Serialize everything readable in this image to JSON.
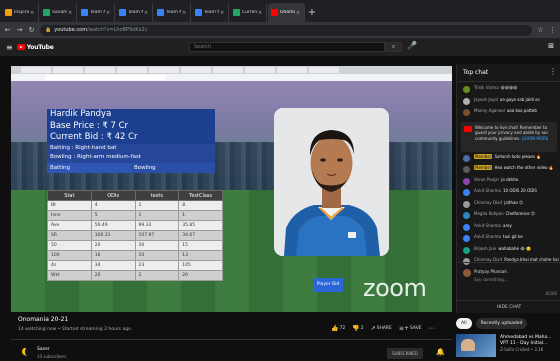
{
  "browser": {
    "tabs": [
      {
        "title": "Inspiration Desk - Bra",
        "color": "#f59e0b"
      },
      {
        "title": "Sanam Bai - Google Sheets",
        "color": "#22a565"
      },
      {
        "title": "Team Number 2 - Radhe",
        "color": "#3b82f6"
      },
      {
        "title": "Team Number 3 - Mugal",
        "color": "#3b82f6"
      },
      {
        "title": "Team Number 3 - Utkarsh",
        "color": "#3b82f6"
      },
      {
        "title": "Team Number 7 - Sukan",
        "color": "#3b82f6"
      },
      {
        "title": "Current allocation cricket",
        "color": "#22a565"
      },
      {
        "title": "Onomania 20-21 - YouTube",
        "color": "#ff0000",
        "active": true
      }
    ],
    "new_tab": "+",
    "url_host": "youtube.com",
    "url_path": "/watch?v=LhoBP9oKx2c"
  },
  "youtube_header": {
    "logo_text": "YouTube",
    "search_placeholder": "Search"
  },
  "video": {
    "player_card": {
      "name": "Hardik Pandya",
      "base_price": "Base Price : ₹ 7 Cr",
      "current_bid": "Current Bid : ₹ 42 Cr",
      "batting_style": "Batting : Right-hand bat",
      "bowling_style": "Bowling : Right-arm medium-fast",
      "role_left": "Batting",
      "role_right": "Bowling"
    },
    "stats_table": {
      "headers": [
        "Stat",
        "ODIs",
        "tests",
        "TestClass"
      ],
      "rows": [
        [
          "Bt",
          "4",
          "1",
          "8"
        ],
        [
          "Inns",
          "5",
          "1",
          "1"
        ],
        [
          "Ave",
          "56.49",
          "99.33",
          "35.85"
        ],
        [
          "SR",
          "100.31",
          "107.97",
          "34.67"
        ],
        [
          "50",
          "20",
          "20",
          "15"
        ],
        [
          "100",
          "16",
          "10",
          "13"
        ],
        [
          "4s",
          "34",
          "23",
          "105"
        ],
        [
          "Wkt",
          "20",
          "2",
          "20"
        ]
      ]
    },
    "player_button": "Player Bid",
    "watermark": "zoom"
  },
  "video_info": {
    "title": "Onomania 20-21",
    "meta": "14 watching now • Started streaming 2 hours ago",
    "actions": [
      {
        "icon": "thumbs-up-icon",
        "glyph": "👍",
        "label": "72"
      },
      {
        "icon": "thumbs-down-icon",
        "glyph": "👎",
        "label": "2"
      },
      {
        "icon": "share-icon",
        "glyph": "↗",
        "label": "SHARE"
      },
      {
        "icon": "save-icon",
        "glyph": "≡+",
        "label": "SAVE"
      },
      {
        "icon": "more-icon",
        "glyph": "⋯",
        "label": ""
      }
    ],
    "channel_name": "Saser",
    "channel_subs": "10 subscribers",
    "subscribe_label": "SUBSCRIBED"
  },
  "chat": {
    "title": "Top chat",
    "pinned": {
      "text": "Welcome to live chat! Remember to guard your privacy and abide by our community guidelines.",
      "link": "LEARN MORE"
    },
    "messages": [
      {
        "author": "Trinik Varma",
        "text": "😀😀😀😀",
        "color": "#6b8e23"
      },
      {
        "author": "Jayesh Joyal",
        "text": "aa gaye sab jaldi se",
        "color": "#b0b0b0"
      },
      {
        "author": "Manny Agarwal",
        "text": "aaa koo patteb",
        "color": "#7a5230"
      },
      {
        "author": "Mohit",
        "badge": "Member",
        "text": "Saharsh koto pleaes 🔥",
        "color": "#4a6fa5"
      },
      {
        "author": "",
        "badge": "Member",
        "text": "Hea watch the other video 🔥",
        "color": "#5a5a5a"
      },
      {
        "author": "Varun Poojar",
        "text": "jo dekho",
        "color": "#8e44ad"
      },
      {
        "author": "Ankit Sharma",
        "text": "10 ODIS 20 ODIS",
        "color": "#3b82f6"
      },
      {
        "author": "Chinmay Dixit",
        "text": "jolthao 😊",
        "color": "#9b9b9b"
      },
      {
        "author": "Megha Kohpon",
        "text": "Chelforence 😊",
        "color": "#2e86c1"
      },
      {
        "author": "Ankit Sharma",
        "text": "arey",
        "color": "#3b82f6"
      },
      {
        "author": "Ankit Sharma",
        "text": "tusi git ke",
        "color": "#3b82f6"
      },
      {
        "author": "Brijesh Jain",
        "text": "wahabahe 😂 🙂",
        "color": "#16a085"
      },
      {
        "author": "Chinmay Dixit",
        "text": "Pandya bhai mat chahe hai",
        "color": "#9b9b9b"
      }
    ],
    "input_name": "Pratyay Pharoah",
    "input_placeholder": "Say something...",
    "input_count": "0/200",
    "hide_chat": "HIDE CHAT"
  },
  "sidebar": {
    "chips": [
      "All",
      "Recently uploaded"
    ],
    "recommended": {
      "title": "Ahmedabad vs Maha... VPT 11 - Day Initial...",
      "channel": "Z-Safin Cricket • 3.1K"
    }
  }
}
